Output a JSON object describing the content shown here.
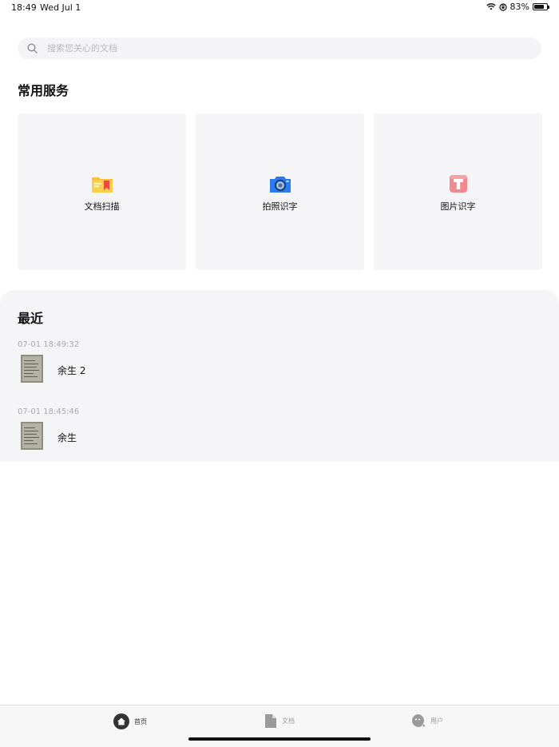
{
  "status_bar": {
    "time": "18:49",
    "date": "Wed Jul 1",
    "battery_percent": "83%",
    "battery_level": 0.83
  },
  "search": {
    "placeholder": "搜索您关心的文档"
  },
  "common_services": {
    "title": "常用服务",
    "items": [
      {
        "label": "文档扫描",
        "icon": "folder-bookmark-icon"
      },
      {
        "label": "拍照识字",
        "icon": "camera-icon"
      },
      {
        "label": "图片识字",
        "icon": "text-t-icon"
      }
    ]
  },
  "recent": {
    "title": "最近",
    "items": [
      {
        "time": "07-01 18:49:32",
        "name": "余生 2"
      },
      {
        "time": "07-01 18:45:46",
        "name": "余生"
      }
    ]
  },
  "tab_bar": {
    "tabs": [
      {
        "label": "首页",
        "icon": "home-icon",
        "active": true
      },
      {
        "label": "文档",
        "icon": "document-icon",
        "active": false
      },
      {
        "label": "用户",
        "icon": "user-icon",
        "active": false
      }
    ]
  },
  "colors": {
    "accent": "#333333",
    "inactive": "#9a9a9a",
    "card_bg": "#f5f5f7",
    "camera": "#2d7bf4",
    "folder": "#f7c33c",
    "bookmark": "#e94b3c",
    "text_icon": "#f0898e"
  }
}
